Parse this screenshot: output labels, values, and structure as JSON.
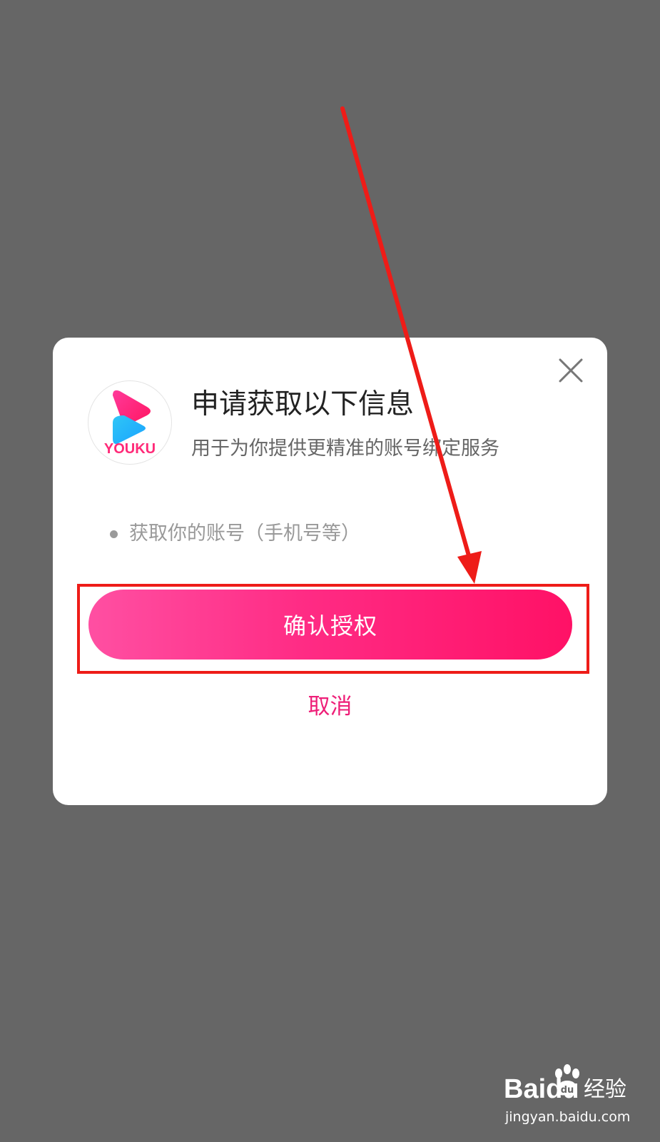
{
  "dialog": {
    "logo_text": "YOUKU",
    "title": "申请获取以下信息",
    "subtitle": "用于为你提供更精准的账号绑定服务",
    "permissions": [
      {
        "label": "获取你的账号（手机号等）"
      }
    ],
    "confirm_label": "确认授权",
    "cancel_label": "取消"
  },
  "watermark": {
    "brand": "Baidu",
    "brand_suffix": "经验",
    "url": "jingyan.baidu.com"
  },
  "colors": {
    "overlay": "#666666",
    "accent_pink": "#ff1a70",
    "cancel_text": "#ee1f78",
    "annotation_red": "#ee1c18"
  },
  "icons": {
    "close": "close-icon",
    "logo": "youku-logo",
    "bullet": "bullet-dot",
    "annotation_arrow": "arrow-icon",
    "watermark_paw": "paw-icon"
  }
}
